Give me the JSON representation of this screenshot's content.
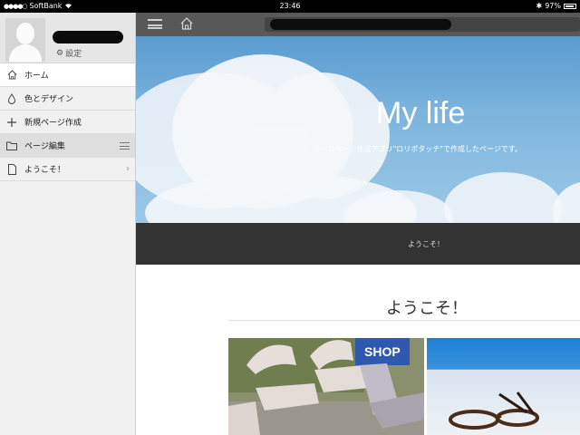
{
  "status_bar": {
    "carrier": "SoftBank",
    "time": "23:46",
    "battery": "97%",
    "battery_level": 0.97
  },
  "sidebar": {
    "settings_label": "設定",
    "items": [
      {
        "label": "ホーム",
        "icon": "home-icon"
      },
      {
        "label": "色とデザイン",
        "icon": "drop-icon"
      },
      {
        "label": "新規ページ作成",
        "icon": "plus-icon"
      },
      {
        "label": "ページ編集",
        "icon": "folder-icon"
      },
      {
        "label": "ようこそ！",
        "icon": "page-icon"
      }
    ]
  },
  "hero": {
    "title": "My life",
    "subtitle": "ホームページ作成アプリ\"ロリポタッチ\"で作成したページです。"
  },
  "nav_strip": {
    "label": "ようこそ！"
  },
  "content": {
    "title": "ようこそ！",
    "shop_sign": "SHOP"
  }
}
